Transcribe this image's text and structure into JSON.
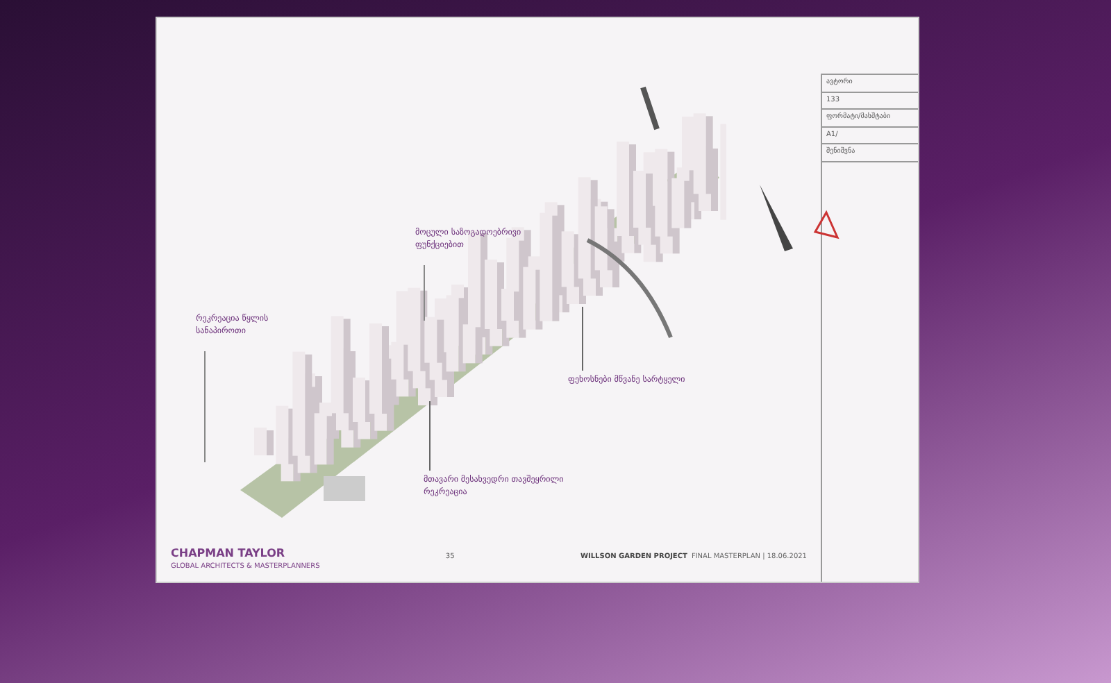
{
  "title_block": {
    "rows": [
      "ავტორი",
      "133",
      "ფორმატი/მასშტაბი",
      "A1/",
      "შენიშვნა"
    ]
  },
  "annotations": [
    {
      "text": "რეკრეაცია წყლის სანაპიროთი",
      "kind": "below"
    },
    {
      "text": "მოცული საზოგადოებრივი ფუნქციებით",
      "kind": "below"
    },
    {
      "text": "ფეხოსნები მწვანე სარტყელი",
      "kind": "above"
    },
    {
      "text": "მთავარი მესახვედრი თავშეყრილი რეკრეაცია",
      "kind": "above"
    }
  ],
  "footer": {
    "brand": "CHAPMAN TAYLOR",
    "tagline": "GLOBAL ARCHITECTS & MASTERPLANNERS",
    "page": "35",
    "project": "WILLSON GARDEN PROJECT",
    "subtitle": "FINAL MASTERPLAN | 18.06.2021"
  }
}
